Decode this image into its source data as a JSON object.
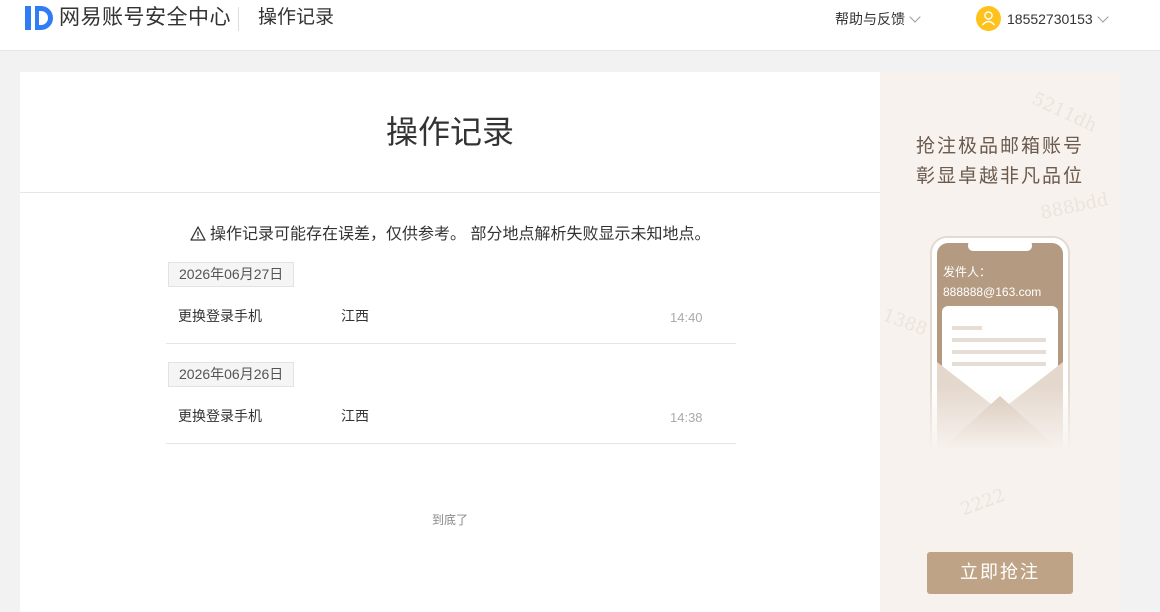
{
  "header": {
    "brand": "网易账号安全中心",
    "page": "操作记录",
    "help": "帮助与反馈",
    "user": "18552730153"
  },
  "main": {
    "title": "操作记录",
    "notice": "操作记录可能存在误差，仅供参考。 部分地点解析失败显示未知地点。",
    "records": [
      {
        "date": "2026年06月27日",
        "action": "更换登录手机",
        "location": "江西",
        "time": "14:40"
      },
      {
        "date": "2026年06月26日",
        "action": "更换登录手机",
        "location": "江西",
        "time": "14:38"
      }
    ],
    "end_text": "到底了"
  },
  "ad": {
    "line1": "抢注极品邮箱账号",
    "line2": "彰显卓越非凡品位",
    "sender_label": "发件人：",
    "sender_email": "888888@163.com",
    "button": "立即抢注",
    "watermarks": [
      "5211dh",
      "888bdd",
      "2222",
      "1388"
    ]
  },
  "colors": {
    "logo_blue": "#2f7cf6",
    "avatar": "#ffc21c",
    "ad_button": "#bfa387",
    "ad_text": "#6b5a4e"
  }
}
